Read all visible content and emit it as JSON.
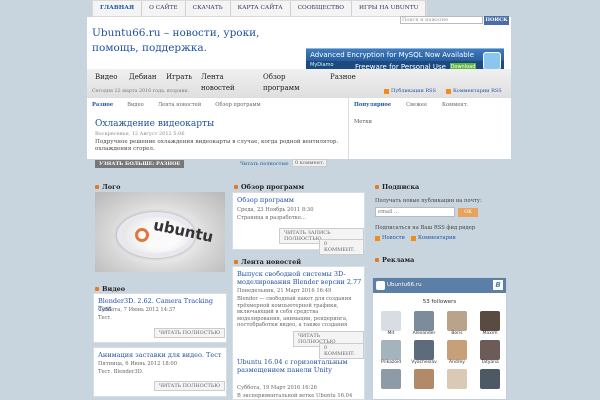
{
  "topnav": [
    "ГЛАВНАЯ",
    "О САЙТЕ",
    "СКАЧАТЬ",
    "КАРТА САЙТА",
    "СООБЩЕСТВО",
    "ИГРЫ НА UBUNTU"
  ],
  "site": {
    "title": "Ubuntu66.ru – новости, уроки, помощь, поддержка."
  },
  "search": {
    "placeholder": "Поиск и нажатие",
    "button": "ПОИСК"
  },
  "ad": {
    "line1": "Advanced Encryption for MySQL Now Available",
    "line2": "Freeware for Personal Use",
    "download": "Download",
    "brand": "MyDiamo"
  },
  "mainnav": [
    "Видео",
    "Дебиан",
    "Играть",
    "Лента новостей",
    "Обзор программ",
    "Разное"
  ],
  "date": "Сегодня 22 марта 2016 года, вторник.",
  "rss": {
    "posts": "Публикации RSS",
    "comments": "Комментарии RSS"
  },
  "tabs_left": [
    "Разное",
    "Видео",
    "Лента новостей",
    "Обзор программ"
  ],
  "tabs_right": [
    "Популярное",
    "Свежее",
    "Коммент."
  ],
  "tags_label": "Метки",
  "featured": {
    "title": "Охлаждение видеокарты",
    "date": "Воскресенье, 12 Август 2012 5:06",
    "text": "Подручное решение охлаждения видеокарты в случае, когда родной вентилятор. охлаждения сгорел.",
    "tag_button": "УЗНАТЬ БОЛЬШЕ: РАЗНОЕ",
    "read_more": "Читать полностью",
    "comments": "0 коммент."
  },
  "col_logo": {
    "heading": "Лого",
    "logo_text": "ubuntu"
  },
  "col_video": {
    "heading": "Видео",
    "items": [
      {
        "title": "Blender3D. 2.62. Camera Tracking Test",
        "date": "Суббота, 7 Июнь 2012 14:37",
        "text": "Тест.",
        "button": "ЧИТАТЬ ПОЛНОСТЬЮ"
      },
      {
        "title": "Анимация заставки для видео. Тест",
        "date": "Пятница, 6 Июнь 2012 18:00",
        "text": "Тест. Blender3D.",
        "button": "ЧИТАТЬ ПОЛНОСТЬЮ"
      }
    ]
  },
  "col_review": {
    "heading": "Обзор программ",
    "title": "Обзор программ",
    "date": "Среда, 23 Ноябрь 2011 8:30",
    "text": "Страница в разработке...",
    "button": "ЧИТАТЬ ЗАПИСЬ ПОЛНОСТЬЮ",
    "comments": "0 КОММЕНТ."
  },
  "col_news": {
    "heading": "Лента новостей",
    "items": [
      {
        "title": "Выпуск свободной системы 3D-моделирования Blender версии 2.77",
        "date": "Понедельник, 21 Март 2016 16:49",
        "text": "Blender — свободный пакет для создания трёхмерной компьютерной графики, включающий в себя средства моделирования, анимации, рендеринга, постобработки видео, а также создания интерактивных игр.Характерной особенностью ...",
        "button": "ЧИТАТЬ ПОЛНОСТЬЮ",
        "comments": "0 КОММЕНТ."
      },
      {
        "title": "Ubuntu 16.04 с горизонтальным размещением панели Unity",
        "date": "Суббота, 19 Март 2016 16:26",
        "text": "В  экспериментальной  ветке  Ubuntu 16.04"
      }
    ]
  },
  "col_subscribe": {
    "heading": "Подписка",
    "text": "Получать новые публикации на почту:",
    "email_placeholder": "email ...",
    "ok": "OK",
    "rss_text": "Подписаться на Ваш RSS фид ридер",
    "news": "Новости",
    "comments": "Комментарии"
  },
  "col_ads": {
    "heading": "Реклама"
  },
  "vk": {
    "name": "Ubuntu66.ru",
    "followers": "53 followers",
    "avatars": [
      {
        "name": "Mit",
        "color": "#d7dde3"
      },
      {
        "name": "Alexander",
        "color": "#7d8c9b"
      },
      {
        "name": "Boris",
        "color": "#b9a48b"
      },
      {
        "name": "Maxim",
        "color": "#5a4b41"
      },
      {
        "name": "Prikazoid",
        "color": "#a5b3bd"
      },
      {
        "name": "Vyacheslav",
        "color": "#5d6b7a"
      },
      {
        "name": "Andrey",
        "color": "#c7a07a"
      },
      {
        "name": "Tatyana",
        "color": "#6d5b58"
      },
      {
        "name": "",
        "color": "#8e9aa6"
      },
      {
        "name": "",
        "color": "#b28a6a"
      },
      {
        "name": "",
        "color": "#d9c9b5"
      },
      {
        "name": "",
        "color": "#4d5a66"
      }
    ]
  },
  "colors": {
    "accent": "#1f4f9f",
    "bullet": "#e57a1f",
    "vk": "#5b7fa6",
    "background": "#c9d5de"
  }
}
